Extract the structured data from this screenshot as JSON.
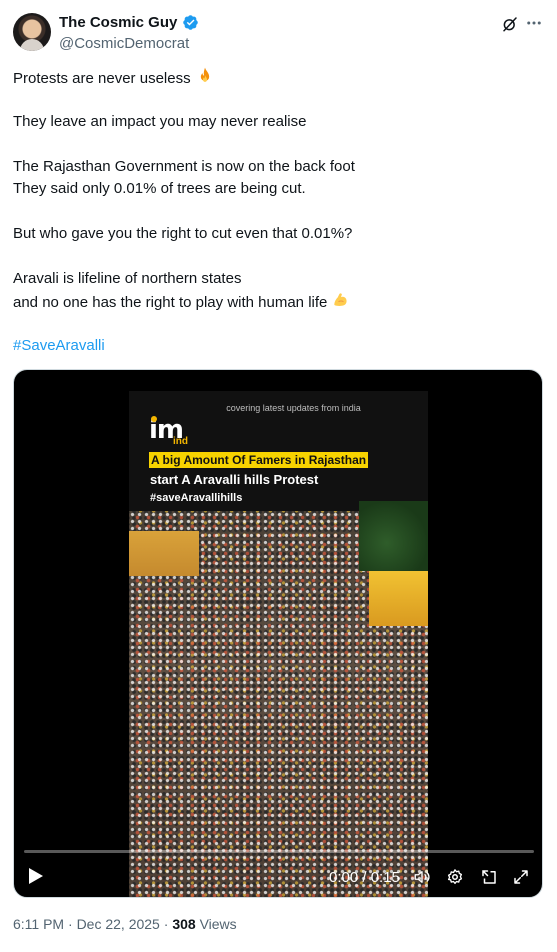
{
  "author": {
    "name": "The Cosmic Guy",
    "handle": "@CosmicDemocrat"
  },
  "icons": {
    "verified": "verified-badge-icon",
    "grok": "grok-icon",
    "more": "more-icon",
    "fire": "fire-emoji-icon",
    "muscle": "flexed-biceps-emoji-icon"
  },
  "tweet": {
    "line1": "Protests are never useless",
    "line2": "They leave an impact you may never realise",
    "line3": "The Rajasthan Government is now on the back foot",
    "line4": "They said only 0.01% of trees are being cut.",
    "line5": "But who gave you the right to cut even that 0.01%?",
    "line6": "Aravali is lifeline of northern states",
    "line7": "and no one has the right to play with human life",
    "hashtag": "#SaveAravalli"
  },
  "video": {
    "overlay_small": "covering latest updates from india",
    "logo_im": "im",
    "logo_ind": "ind",
    "headline_yellow": "A big Amount Of Famers in Rajasthan",
    "headline_white": "start A Aravalli hills Protest",
    "headline_tag": "#saveAravallihills",
    "time": "0:00 / 0:15",
    "progress_fraction": 0.0
  },
  "meta": {
    "time": "6:11 PM",
    "sep1": "·",
    "date": "Dec 22, 2025",
    "sep2": "·",
    "views_count": "308",
    "views_label": "Views"
  },
  "colors": {
    "accent": "#1d9bf0",
    "text": "#0f1419",
    "muted": "#536471",
    "headline_highlight": "#f7d300"
  }
}
